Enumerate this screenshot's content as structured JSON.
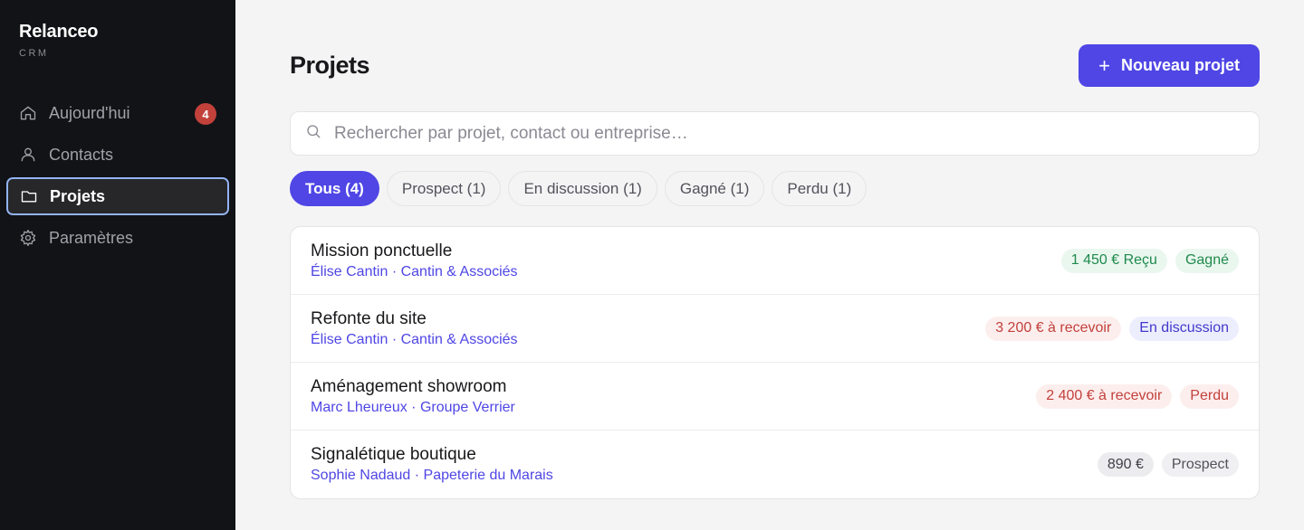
{
  "brand": {
    "name": "Relanceo",
    "sub": "CRM"
  },
  "nav": [
    {
      "label": "Aujourd'hui",
      "icon": "home-icon",
      "badge": "4"
    },
    {
      "label": "Contacts",
      "icon": "user-icon"
    },
    {
      "label": "Projets",
      "icon": "folder-icon",
      "active": true
    },
    {
      "label": "Paramètres",
      "icon": "gear-icon"
    }
  ],
  "header": {
    "title": "Projets",
    "new_button": "Nouveau projet"
  },
  "search": {
    "placeholder": "Rechercher par projet, contact ou entreprise…",
    "value": ""
  },
  "filters": [
    {
      "label": "Tous (4)",
      "active": true
    },
    {
      "label": "Prospect (1)"
    },
    {
      "label": "En discussion (1)"
    },
    {
      "label": "Gagné (1)"
    },
    {
      "label": "Perdu (1)"
    }
  ],
  "projects": [
    {
      "title": "Mission ponctuelle",
      "sub": "Élise Cantin · Cantin & Associés",
      "amount": "1 450 € Reçu",
      "status": "Gagné"
    },
    {
      "title": "Refonte du site",
      "sub": "Élise Cantin · Cantin & Associés",
      "amount": "3 200 € à recevoir",
      "status": "En discussion"
    },
    {
      "title": "Aménagement showroom",
      "sub": "Marc Lheureux · Groupe Verrier",
      "amount": "2 400 € à recevoir",
      "status": "Perdu"
    },
    {
      "title": "Signalétique boutique",
      "sub": "Sophie Nadaud · Papeterie du Marais",
      "amount": "890 €",
      "status": "Prospect"
    }
  ],
  "colors": {
    "accent": "#4f46e5",
    "sidebar": "#121316",
    "badge": "#c2413b"
  }
}
